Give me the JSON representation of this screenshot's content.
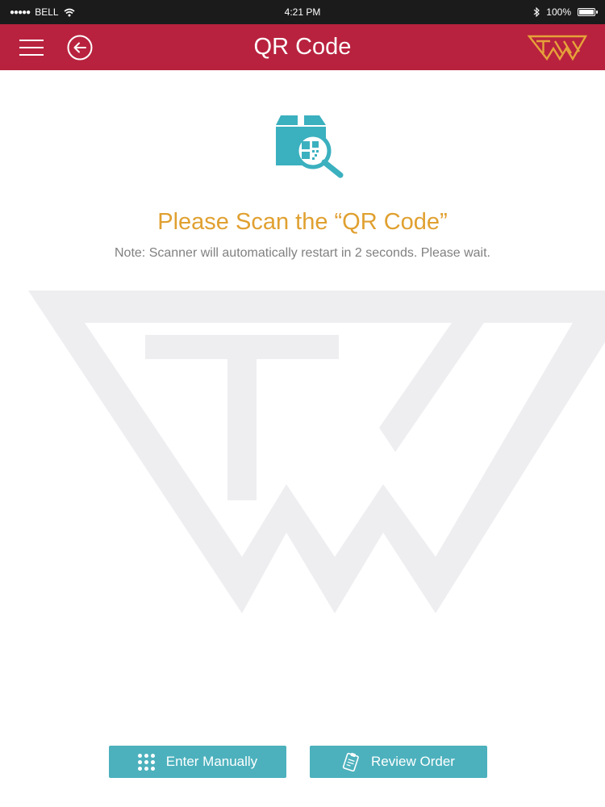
{
  "status_bar": {
    "carrier": "BELL",
    "time": "4:21 PM",
    "battery": "100%",
    "battery_level": 1.0,
    "icons": [
      "signal-dots-icon",
      "wifi-icon",
      "bluetooth-icon",
      "battery-icon"
    ]
  },
  "header": {
    "title": "QR Code",
    "icons": [
      "menu-icon",
      "back-arrow-icon",
      "brand-logo"
    ],
    "background_color": "#b8223e"
  },
  "main": {
    "icon": "qr-scan-box-icon",
    "heading": "Please Scan the “QR Code”",
    "note": "Note: Scanner will automatically restart in 2 seconds. Please wait.",
    "heading_color": "#e0a030",
    "watermark": "brand-logo-watermark"
  },
  "actions": {
    "enter_manually": {
      "label": "Enter Manually",
      "icon": "keypad-icon"
    },
    "review_order": {
      "label": "Review Order",
      "icon": "clipboard-icon"
    },
    "button_color": "#4cb1bd"
  }
}
